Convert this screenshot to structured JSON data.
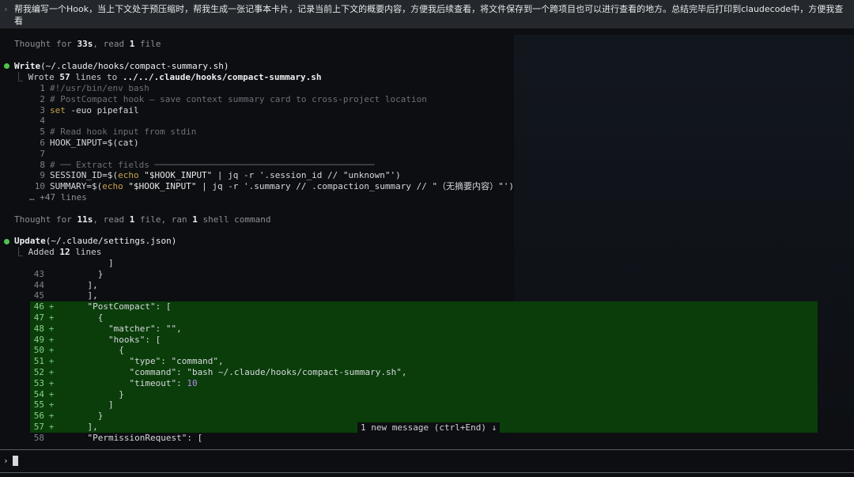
{
  "prompt": {
    "caret": "›",
    "text": "帮我编写一个Hook，当上下文处于预压缩时，帮我生成一张记事本卡片，记录当前上下文的概要内容，方便我后续查看，将文件保存到一个跨项目也可以进行查看的地方。总结完毕后打印到claudecode中，方便我查看"
  },
  "thought1": {
    "prefix": "Thought for ",
    "time": "33s",
    "mid": ", read ",
    "count": "1",
    "suffix": " file"
  },
  "write": {
    "tool": "Write",
    "arg": "(~/.claude/hooks/compact-summary.sh)",
    "result_prefix": "Wrote ",
    "result_count": "57",
    "result_mid": " lines to ",
    "result_path": "../../.claude/hooks/compact-summary.sh",
    "more": "… +47 lines",
    "lines": [
      {
        "n": "1",
        "parts": [
          {
            "c": "cm",
            "t": "#!/usr/bin/env bash"
          }
        ]
      },
      {
        "n": "2",
        "parts": [
          {
            "c": "cm",
            "t": "# PostCompact hook — save context summary card to cross-project location"
          }
        ]
      },
      {
        "n": "3",
        "parts": [
          {
            "c": "kw",
            "t": "set"
          },
          {
            "c": "",
            "t": " -euo pipefail"
          }
        ]
      },
      {
        "n": "4",
        "parts": []
      },
      {
        "n": "5",
        "parts": [
          {
            "c": "cm",
            "t": "# Read hook input from stdin"
          }
        ]
      },
      {
        "n": "6",
        "parts": [
          {
            "c": "",
            "t": "HOOK_INPUT=$(cat)"
          }
        ]
      },
      {
        "n": "7",
        "parts": []
      },
      {
        "n": "8",
        "parts": [
          {
            "c": "cm",
            "t": "# ── Extract fields ──────────────────────────────────────────"
          }
        ]
      },
      {
        "n": "9",
        "parts": [
          {
            "c": "",
            "t": "SESSION_ID=$("
          },
          {
            "c": "kw",
            "t": "echo"
          },
          {
            "c": "str",
            "t": " \"$HOOK_INPUT\""
          },
          {
            "c": "",
            "t": " | jq -r '.session_id // \"unknown\"')"
          }
        ]
      },
      {
        "n": "10",
        "parts": [
          {
            "c": "",
            "t": "SUMMARY=$("
          },
          {
            "c": "kw",
            "t": "echo"
          },
          {
            "c": "str",
            "t": " \"$HOOK_INPUT\""
          },
          {
            "c": "",
            "t": " | jq -r '.summary // .compaction_summary // \"（无摘要内容）\"')"
          }
        ]
      }
    ]
  },
  "thought2": {
    "prefix": "Thought for ",
    "time": "11s",
    "mid": ", read ",
    "count": "1",
    "mid2": " file, ran ",
    "count2": "1",
    "suffix": " shell command"
  },
  "update": {
    "tool": "Update",
    "arg": "(~/.claude/settings.json)",
    "result_prefix": "Added ",
    "result_count": "12",
    "result_suffix": " lines",
    "lines": [
      {
        "n": "",
        "add": false,
        "parts": [
          {
            "c": "",
            "t": "        ]"
          }
        ]
      },
      {
        "n": "43",
        "add": false,
        "parts": [
          {
            "c": "",
            "t": "      }"
          }
        ]
      },
      {
        "n": "44",
        "add": false,
        "parts": [
          {
            "c": "",
            "t": "    ],"
          }
        ]
      },
      {
        "n": "45",
        "add": false,
        "parts": [
          {
            "c": "",
            "t": "    ],"
          }
        ]
      },
      {
        "n": "46",
        "add": true,
        "parts": [
          {
            "c": "",
            "t": "    \"PostCompact\": ["
          }
        ]
      },
      {
        "n": "47",
        "add": true,
        "parts": [
          {
            "c": "",
            "t": "      {"
          }
        ]
      },
      {
        "n": "48",
        "add": true,
        "parts": [
          {
            "c": "",
            "t": "        \"matcher\": \"\","
          }
        ]
      },
      {
        "n": "49",
        "add": true,
        "parts": [
          {
            "c": "",
            "t": "        \"hooks\": ["
          }
        ]
      },
      {
        "n": "50",
        "add": true,
        "parts": [
          {
            "c": "",
            "t": "          {"
          }
        ]
      },
      {
        "n": "51",
        "add": true,
        "parts": [
          {
            "c": "",
            "t": "            \"type\": \"command\","
          }
        ]
      },
      {
        "n": "52",
        "add": true,
        "parts": [
          {
            "c": "",
            "t": "            \"command\": \"bash ~/.claude/hooks/compact-summary.sh\","
          }
        ]
      },
      {
        "n": "53",
        "add": true,
        "parts": [
          {
            "c": "",
            "t": "            \"timeout\": "
          },
          {
            "c": "num",
            "t": "10"
          }
        ]
      },
      {
        "n": "54",
        "add": true,
        "parts": [
          {
            "c": "",
            "t": "          }"
          }
        ]
      },
      {
        "n": "55",
        "add": true,
        "parts": [
          {
            "c": "",
            "t": "        ]"
          }
        ]
      },
      {
        "n": "56",
        "add": true,
        "parts": [
          {
            "c": "",
            "t": "      }"
          }
        ]
      },
      {
        "n": "57",
        "add": true,
        "parts": [
          {
            "c": "",
            "t": "    ],"
          }
        ]
      },
      {
        "n": "58",
        "add": false,
        "parts": [
          {
            "c": "",
            "t": "    \"PermissionRequest\": ["
          }
        ]
      }
    ]
  },
  "toast": "1 new message (ctrl+End) ↓",
  "input": {
    "caret": "›",
    "value": ""
  },
  "colors": {
    "added_bg": "#0a3d0a",
    "bullet": "#4fc44f",
    "number": "#b68cf0"
  }
}
